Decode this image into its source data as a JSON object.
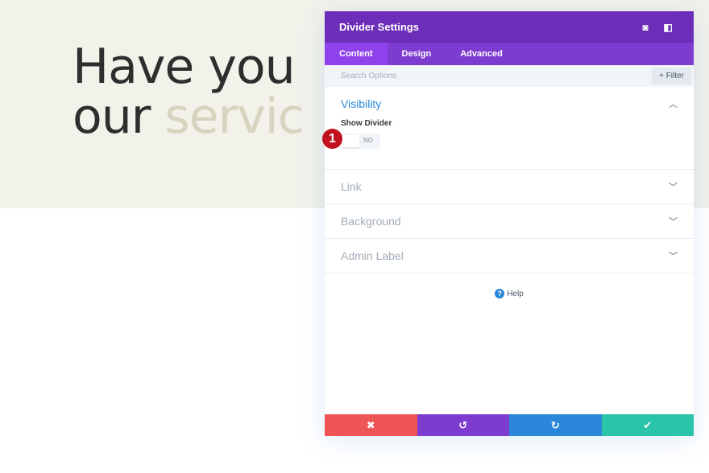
{
  "hero": {
    "line1": "Have you",
    "line2_plain": "our ",
    "line2_accent": "servic"
  },
  "panel": {
    "title": "Divider Settings",
    "header_icons": [
      "focus-icon",
      "sidebar-toggle-icon"
    ],
    "tabs": [
      {
        "label": "Content",
        "active": true
      },
      {
        "label": "Design"
      },
      {
        "label": "Advanced"
      }
    ],
    "search_placeholder": "Search Options",
    "filter_label": "+ Filter",
    "sections": {
      "visibility": {
        "title": "Visibility",
        "field_label": "Show Divider",
        "toggle_value": "NO"
      },
      "link": "Link",
      "background": "Background",
      "admin_label": "Admin Label"
    },
    "badge": "1",
    "help": "Help",
    "footer": {
      "cancel_color": "#ef5555",
      "undo_color": "#7e3bd0",
      "redo_color": "#2b87da",
      "save_color": "#29c4a9"
    }
  },
  "colors": {
    "header": "#6c2eb9",
    "tabs": "#7e3bd0",
    "accent": "#2b87da"
  }
}
